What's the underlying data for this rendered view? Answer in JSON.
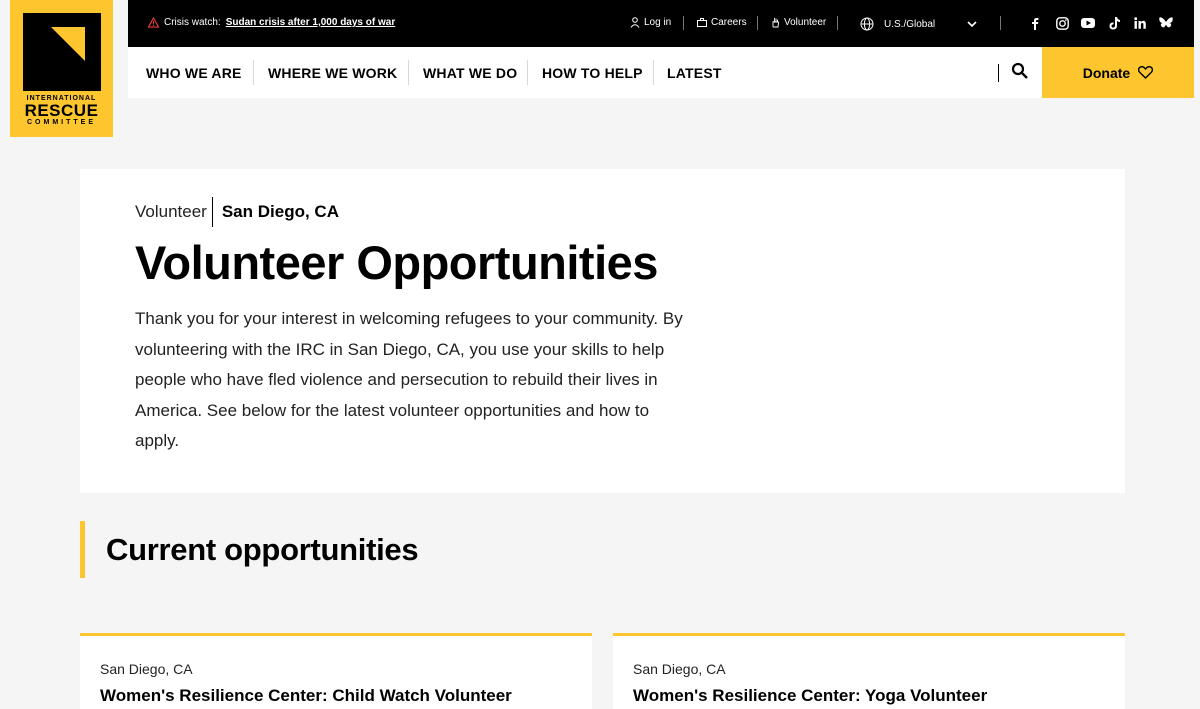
{
  "logo": {
    "line1": "INTERNATIONAL",
    "line2": "RESCUE",
    "line3": "COMMITTEE"
  },
  "topbar": {
    "crisis_label": "Crisis watch:",
    "crisis_link": "Sudan crisis after 1,000 days of war",
    "login": "Log in",
    "careers": "Careers",
    "volunteer": "Volunteer",
    "region": "U.S./Global",
    "social": [
      "facebook-icon",
      "instagram-icon",
      "youtube-icon",
      "tiktok-icon",
      "linkedin-icon",
      "bluesky-icon"
    ]
  },
  "nav": {
    "items": [
      "WHO WE ARE",
      "WHERE WE WORK",
      "WHAT WE DO",
      "HOW TO HELP",
      "LATEST"
    ],
    "donate": "Donate"
  },
  "hero": {
    "breadcrumb_parent": "Volunteer",
    "breadcrumb_current": "San Diego, CA",
    "title": "Volunteer Opportunities",
    "intro": "Thank you for your interest in welcoming refugees to your community. By volunteering with the IRC in San Diego, CA, you use your skills to help people who have fled violence and persecution to rebuild their lives in America. See below for the latest volunteer opportunities and how to apply."
  },
  "opportunities": {
    "heading": "Current opportunities",
    "items": [
      {
        "location": "San Diego, CA",
        "title": "Women's Resilience Center: Child Watch Volunteer"
      },
      {
        "location": "San Diego, CA",
        "title": "Women's Resilience Center: Yoga Volunteer"
      }
    ]
  },
  "colors": {
    "accent": "#fdc62f",
    "topbar": "#000000",
    "background": "#f5f5f5"
  }
}
